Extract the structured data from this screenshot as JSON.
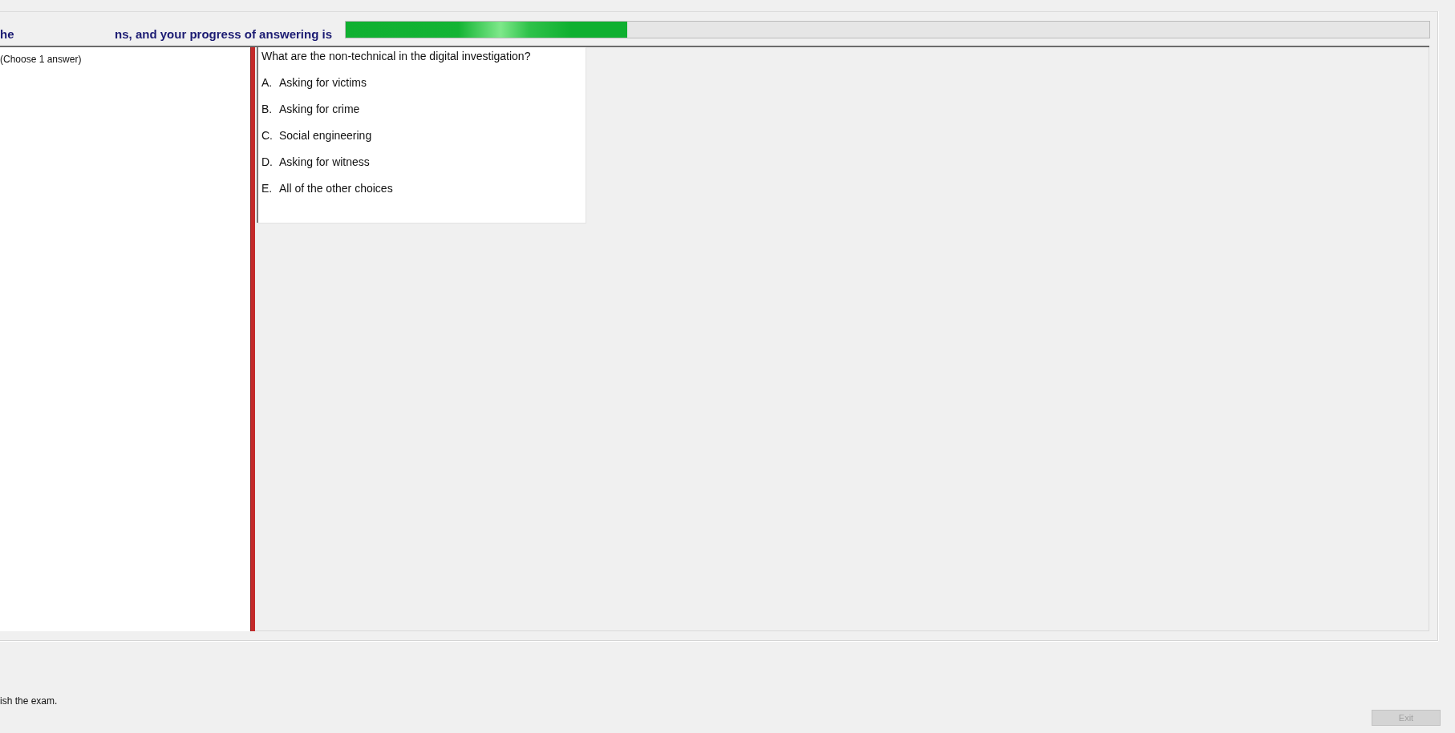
{
  "header": {
    "fragment": "he",
    "text": "ns, and your progress of answering is",
    "progress": {
      "level": 0.26
    }
  },
  "instructions": "(Choose 1 answer)",
  "question": {
    "text": "What are the non-technical in the digital investigation?",
    "options": [
      {
        "label": "A.",
        "text": "Asking for victims"
      },
      {
        "label": "B.",
        "text": "Asking for crime"
      },
      {
        "label": "C.",
        "text": "Social engineering"
      },
      {
        "label": "D.",
        "text": "Asking for witness"
      },
      {
        "label": "E.",
        "text": "All of the other choices"
      }
    ]
  },
  "footer": {
    "note": "ish the exam.",
    "exit_button": {
      "label": "Exit",
      "disabled": true
    }
  }
}
